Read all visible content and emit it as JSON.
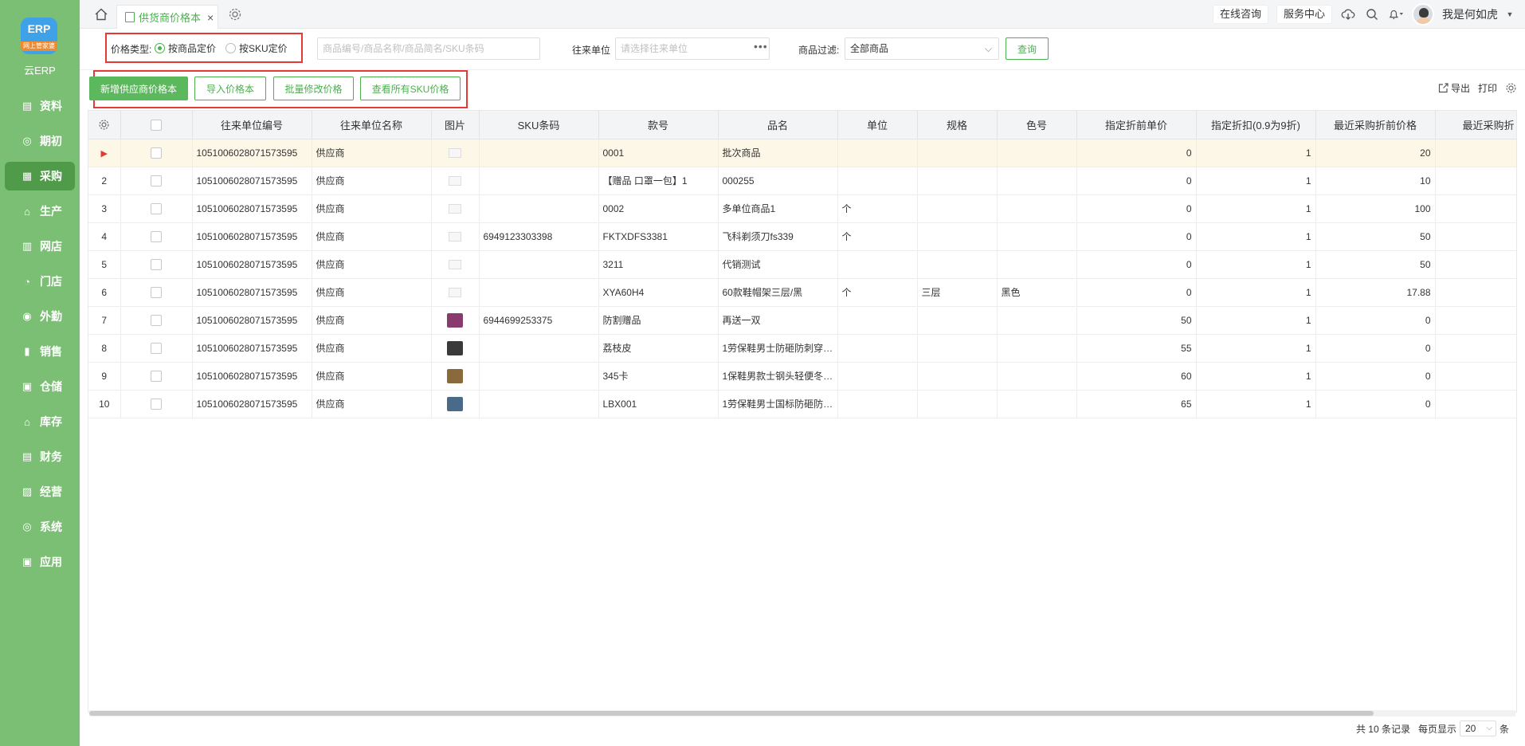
{
  "app": {
    "logo_text": "云ERP",
    "logo_badge": "ERP",
    "logo_strip": "网上管家婆"
  },
  "sidebar": {
    "items": [
      {
        "label": "资料",
        "icon": "document-icon"
      },
      {
        "label": "期初",
        "icon": "target-icon"
      },
      {
        "label": "采购",
        "icon": "purchase-icon",
        "active": true
      },
      {
        "label": "生产",
        "icon": "production-icon"
      },
      {
        "label": "网店",
        "icon": "shop-icon"
      },
      {
        "label": "门店",
        "icon": "store-icon"
      },
      {
        "label": "外勤",
        "icon": "field-icon"
      },
      {
        "label": "销售",
        "icon": "sales-icon"
      },
      {
        "label": "仓储",
        "icon": "warehouse-icon"
      },
      {
        "label": "库存",
        "icon": "inventory-icon"
      },
      {
        "label": "财务",
        "icon": "finance-icon"
      },
      {
        "label": "经营",
        "icon": "business-icon"
      },
      {
        "label": "系统",
        "icon": "system-icon"
      },
      {
        "label": "应用",
        "icon": "apps-icon"
      }
    ]
  },
  "tabs": {
    "active_label": "供货商价格本"
  },
  "header": {
    "online_consult": "在线咨询",
    "service_center": "服务中心",
    "user_name": "我是何如虎"
  },
  "filter": {
    "price_type_label": "价格类型:",
    "radio_goods": "按商品定价",
    "radio_sku": "按SKU定价",
    "search_placeholder": "商品编号/商品名称/商品简名/SKU条码",
    "unit_label": "往来单位",
    "unit_placeholder": "请选择往来单位",
    "goods_filter_label": "商品过滤:",
    "goods_filter_value": "全部商品",
    "query_label": "查询"
  },
  "toolbar": {
    "new_label": "新增供应商价格本",
    "import_label": "导入价格本",
    "batch_label": "批量修改价格",
    "view_sku_label": "查看所有SKU价格",
    "export_label": "导出",
    "print_label": "打印"
  },
  "table": {
    "columns": [
      "往来单位编号",
      "往来单位名称",
      "图片",
      "SKU条码",
      "款号",
      "品名",
      "单位",
      "规格",
      "色号",
      "指定折前单价",
      "指定折扣(0.9为9折)",
      "最近采购折前价格",
      "最近采购折"
    ],
    "rows": [
      {
        "idx": "▶",
        "code": "1051006028071573595",
        "name": "供应商",
        "img": "none",
        "sku": "",
        "style": "0001",
        "product": "批次商品",
        "unit": "",
        "spec": "",
        "color": "",
        "price": "0",
        "discount": "1",
        "last": "20"
      },
      {
        "idx": "2",
        "code": "1051006028071573595",
        "name": "供应商",
        "img": "none",
        "sku": "",
        "style": "【赠品 口罩一包】1",
        "product": "000255",
        "unit": "",
        "spec": "",
        "color": "",
        "price": "0",
        "discount": "1",
        "last": "10"
      },
      {
        "idx": "3",
        "code": "1051006028071573595",
        "name": "供应商",
        "img": "none",
        "sku": "",
        "style": "0002",
        "product": "多单位商品1",
        "unit": "个",
        "spec": "",
        "color": "",
        "price": "0",
        "discount": "1",
        "last": "100"
      },
      {
        "idx": "4",
        "code": "1051006028071573595",
        "name": "供应商",
        "img": "none",
        "sku": "6949123303398",
        "style": "FKTXDFS3381",
        "product": "飞科剃须刀fs339",
        "unit": "个",
        "spec": "",
        "color": "",
        "price": "0",
        "discount": "1",
        "last": "50"
      },
      {
        "idx": "5",
        "code": "1051006028071573595",
        "name": "供应商",
        "img": "none",
        "sku": "",
        "style": "3211",
        "product": "代销测试",
        "unit": "",
        "spec": "",
        "color": "",
        "price": "0",
        "discount": "1",
        "last": "50"
      },
      {
        "idx": "6",
        "code": "1051006028071573595",
        "name": "供应商",
        "img": "none",
        "sku": "",
        "style": "XYA60H4",
        "product": "60款鞋帽架三层/黑",
        "unit": "个",
        "spec": "三层",
        "color": "黑色",
        "price": "0",
        "discount": "1",
        "last": "17.88"
      },
      {
        "idx": "7",
        "code": "1051006028071573595",
        "name": "供应商",
        "img": "socks",
        "sku": "6944699253375",
        "style": "防割赠品",
        "product": "再送一双",
        "unit": "",
        "spec": "",
        "color": "",
        "price": "50",
        "discount": "1",
        "last": "0"
      },
      {
        "idx": "8",
        "code": "1051006028071573595",
        "name": "供应商",
        "img": "shoe",
        "sku": "",
        "style": "荔枝皮",
        "product": "1劳保鞋男士防砸防刺穿…",
        "unit": "",
        "spec": "",
        "color": "",
        "price": "55",
        "discount": "1",
        "last": "0"
      },
      {
        "idx": "9",
        "code": "1051006028071573595",
        "name": "供应商",
        "img": "boot",
        "sku": "",
        "style": "345卡",
        "product": "1保鞋男款士钢头轻便冬…",
        "unit": "",
        "spec": "",
        "color": "",
        "price": "60",
        "discount": "1",
        "last": "0"
      },
      {
        "idx": "10",
        "code": "1051006028071573595",
        "name": "供应商",
        "img": "sneaker",
        "sku": "",
        "style": "LBX001",
        "product": "1劳保鞋男士国标防砸防…",
        "unit": "",
        "spec": "",
        "color": "",
        "price": "65",
        "discount": "1",
        "last": "0"
      }
    ]
  },
  "footer": {
    "total": "共 10 条记录",
    "per_page_label": "每页显示",
    "per_page": "20",
    "unit": "条"
  },
  "colors": {
    "sidebar": "#7bbf74",
    "accent": "#4caf50",
    "highlight": "#e53935"
  }
}
